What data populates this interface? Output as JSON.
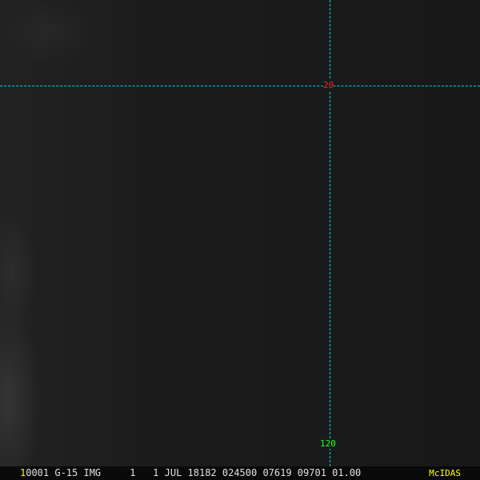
{
  "image": {
    "satellite_display": "GOES-15 IR image"
  },
  "grid": {
    "latitude_label": "20",
    "longitude_label": "120",
    "line_color": "#00d8e8",
    "lat_color": "#ff2020",
    "lon_color": "#20ff20"
  },
  "status_bar": {
    "frame_number": "1",
    "info": "0001 G-15 IMG     1   1 JUL 18182 024500 07619 09701 01.00",
    "logo": "McIDAS"
  }
}
